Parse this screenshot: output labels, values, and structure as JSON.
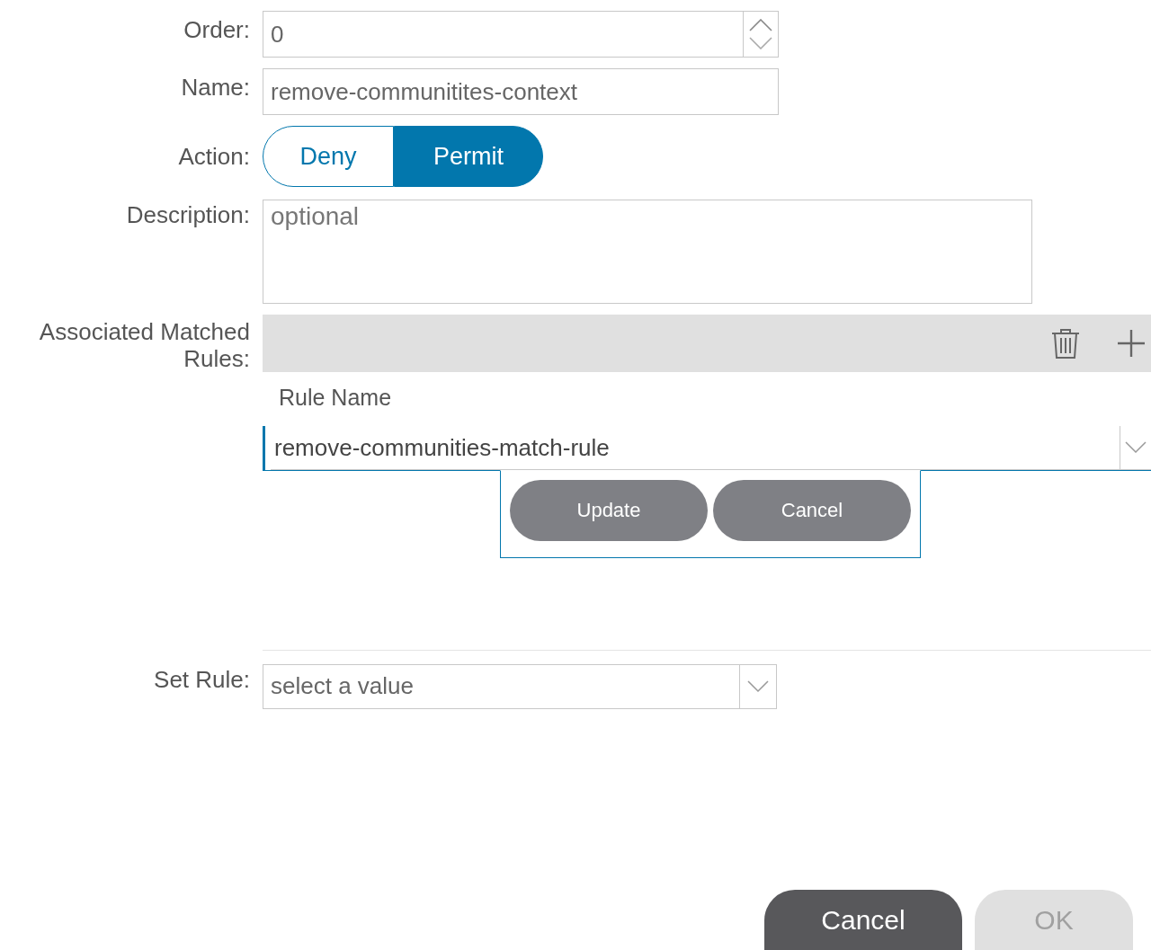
{
  "form": {
    "order": {
      "label": "Order:",
      "value": "0"
    },
    "name": {
      "label": "Name:",
      "value": "remove-communitites-context"
    },
    "action": {
      "label": "Action:",
      "options": [
        {
          "label": "Deny",
          "selected": false
        },
        {
          "label": "Permit",
          "selected": true
        }
      ]
    },
    "description": {
      "label": "Description:",
      "placeholder": "optional"
    },
    "matched_rules": {
      "label": "Associated Matched Rules:",
      "column": "Rule Name",
      "editing_row": {
        "value": "remove-communities-match-rule"
      },
      "row_buttons": [
        "Update",
        "Cancel"
      ]
    },
    "set_rule": {
      "label": "Set Rule:",
      "placeholder": "select a value"
    }
  },
  "buttons": [
    {
      "label": "Cancel",
      "disabled": false
    },
    {
      "label": "OK",
      "disabled": true
    }
  ]
}
